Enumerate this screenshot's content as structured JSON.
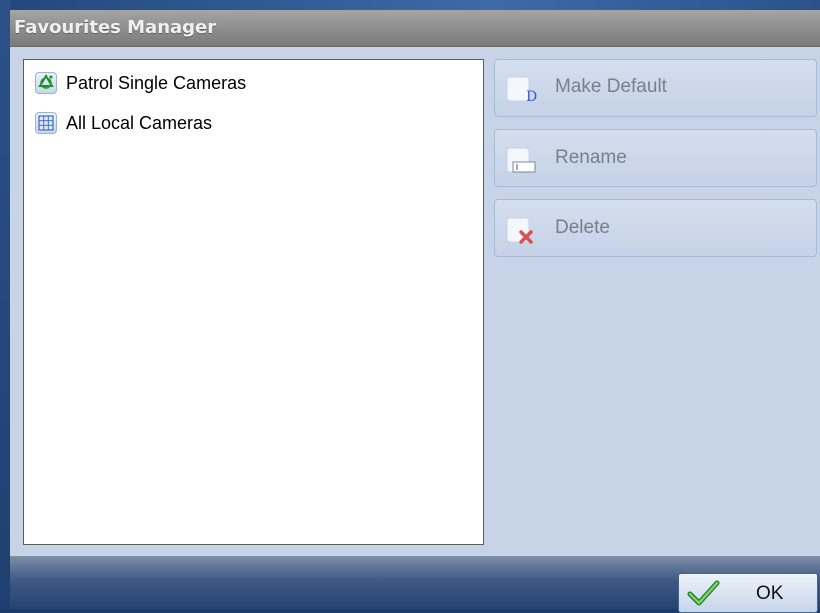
{
  "window": {
    "title": "Favourites Manager"
  },
  "favourites": {
    "items": [
      {
        "label": "Patrol Single Cameras",
        "icon": "patrol-icon"
      },
      {
        "label": "All Local Cameras",
        "icon": "grid-icon"
      }
    ]
  },
  "actions": {
    "make_default_label": "Make Default",
    "rename_label": "Rename",
    "delete_label": "Delete"
  },
  "footer": {
    "ok_label": "OK"
  },
  "colors": {
    "title_bar": "#8f8f8f",
    "panel": "#c7d3e6",
    "footer": "#3f5a85",
    "disabled_text": "#7a7f88"
  }
}
